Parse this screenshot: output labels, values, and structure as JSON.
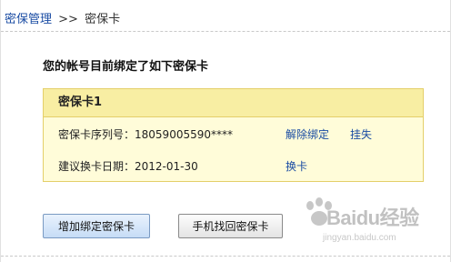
{
  "breadcrumb": {
    "parent": "密保管理",
    "separator": ">>",
    "current": "密保卡"
  },
  "heading": "您的帐号目前绑定了如下密保卡",
  "card": {
    "title": "密保卡1",
    "serial_label": "密保卡序列号：",
    "serial_value": "18059005590****",
    "unbind_link": "解除绑定",
    "report_loss_link": "挂失",
    "renew_label": "建议换卡日期：",
    "renew_date": "2012-01-30",
    "renew_link": "换卡"
  },
  "buttons": {
    "add_bind": "增加绑定密保卡",
    "phone_recover": "手机找回密保卡"
  },
  "watermark": {
    "brand": "Baidu经验",
    "url": "jingyan.baidu.com"
  },
  "colors": {
    "link": "#1a4ca3",
    "card_bg": "#fffcd9",
    "card_header_bg": "#f8eea3",
    "card_border": "#e4cf6a"
  }
}
